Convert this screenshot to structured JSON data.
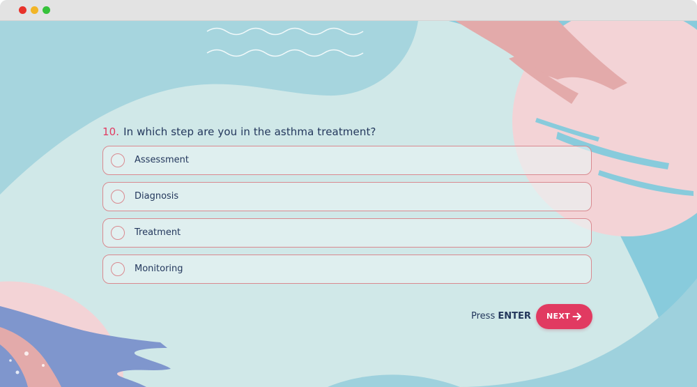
{
  "window": {
    "controls": [
      "close-dot",
      "minimize-dot",
      "maximize-dot"
    ]
  },
  "question": {
    "number": "10.",
    "text": "In which step are you in the asthma treatment?"
  },
  "options": [
    {
      "label": "Assessment",
      "selected": false
    },
    {
      "label": "Diagnosis",
      "selected": false
    },
    {
      "label": "Treatment",
      "selected": false
    },
    {
      "label": "Monitoring",
      "selected": false
    }
  ],
  "footer": {
    "press_text": "Press",
    "key_text": "ENTER",
    "next_label": "NEXT",
    "next_icon": "arrow-right-icon"
  },
  "colors": {
    "accent": "#e13a61",
    "text": "#23375c",
    "option_border": "#d9898f",
    "background": "#d0e8e8",
    "blue_blob": "#a6d5de",
    "pink_blob": "#f3d3d6",
    "brush_blue": "#7f96cd"
  }
}
